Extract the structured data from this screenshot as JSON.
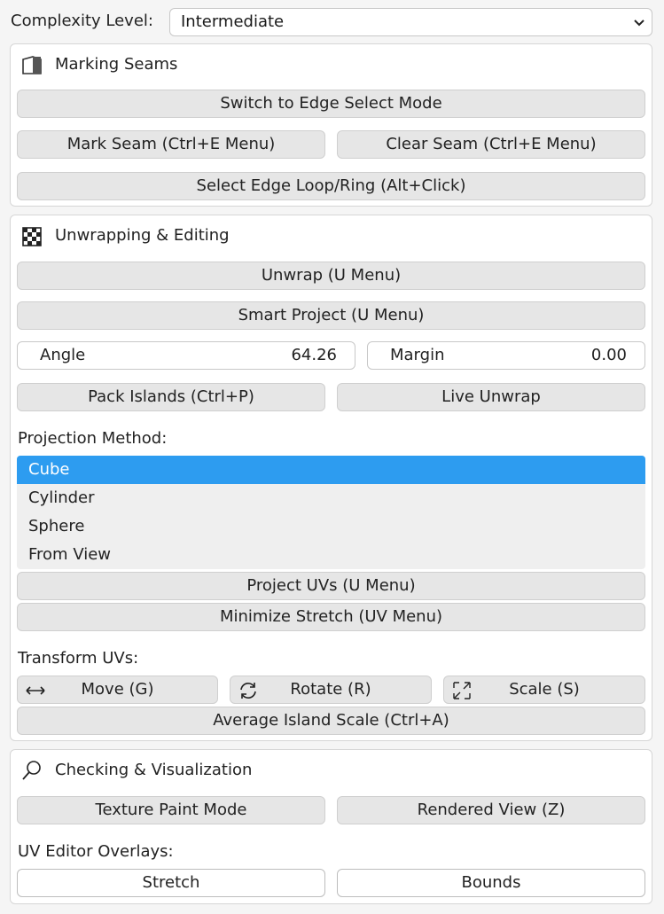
{
  "complexity": {
    "label": "Complexity Level:",
    "value": "Intermediate"
  },
  "marking": {
    "title": "Marking Seams",
    "edge_select": "Switch to Edge Select Mode",
    "mark_seam": "Mark Seam (Ctrl+E Menu)",
    "clear_seam": "Clear Seam (Ctrl+E Menu)",
    "select_loop": "Select Edge Loop/Ring (Alt+Click)"
  },
  "unwrap": {
    "title": "Unwrapping & Editing",
    "unwrap": "Unwrap (U Menu)",
    "smart_project": "Smart Project (U Menu)",
    "angle_label": "Angle",
    "angle_value": "64.26",
    "margin_label": "Margin",
    "margin_value": "0.00",
    "pack_islands": "Pack Islands (Ctrl+P)",
    "live_unwrap": "Live Unwrap",
    "projection_label": "Projection Method:",
    "projection_options": [
      "Cube",
      "Cylinder",
      "Sphere",
      "From View"
    ],
    "projection_selected": "Cube",
    "project_uvs": "Project UVs (U Menu)",
    "minimize_stretch": "Minimize Stretch (UV Menu)",
    "transform_label": "Transform UVs:",
    "move": "Move (G)",
    "rotate": "Rotate (R)",
    "scale": "Scale (S)",
    "average_scale": "Average Island Scale (Ctrl+A)"
  },
  "checking": {
    "title": "Checking & Visualization",
    "texture_paint": "Texture Paint Mode",
    "rendered_view": "Rendered View (Z)",
    "overlays_label": "UV Editor Overlays:",
    "stretch": "Stretch",
    "bounds": "Bounds"
  },
  "colors": {
    "selection": "#2d9cf0",
    "button": "#e6e6e6",
    "panel": "#ffffff"
  }
}
